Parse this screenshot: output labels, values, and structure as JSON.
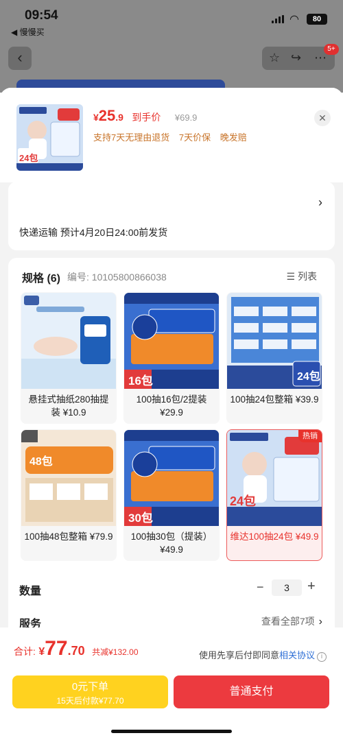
{
  "status": {
    "time": "09:54",
    "back_app": "◀ 慢慢买",
    "battery": "80"
  },
  "background": {
    "badge": "5+"
  },
  "header": {
    "price_symbol": "¥",
    "price_int": "25",
    "price_dec": ".9",
    "price_tag": "到手价",
    "original_price": "¥69.9",
    "tags": [
      "支持7天无理由退货",
      "7天价保",
      "晚发赔"
    ],
    "thumb_text": "24包"
  },
  "shipping": {
    "text": "快递运输  预计4月20日24:00前发货"
  },
  "spec": {
    "title": "规格 (6)",
    "code": "编号: 10105800866038",
    "list_view_label": "列表",
    "options": [
      {
        "name": "悬挂式抽纸280抽提装 ¥10.9",
        "selected": false
      },
      {
        "name": "100抽16包/2提装 ¥29.9",
        "selected": false,
        "img_text": "16包"
      },
      {
        "name": "100抽24包整箱 ¥39.9",
        "selected": false,
        "img_text": "24包"
      },
      {
        "name": "100抽48包整箱 ¥79.9",
        "selected": false,
        "img_text": "48包"
      },
      {
        "name": "100抽30包（提装） ¥49.9",
        "selected": false,
        "img_text": "30包"
      },
      {
        "name": "维达100抽24包 ¥49.9",
        "selected": true,
        "img_text": "24包",
        "badge": "热销"
      }
    ]
  },
  "quantity": {
    "label": "数量",
    "value": "3"
  },
  "service": {
    "label": "服务",
    "link": "查看全部7项"
  },
  "footer": {
    "total_label": "合计:",
    "total_symbol": "¥",
    "total_int": "77",
    "total_dec": ".70",
    "savings": "共减¥132.00",
    "agree_text": "使用先享后付即同意",
    "agree_link": "相关协议",
    "credit_btn_line1": "0元下单",
    "credit_btn_line2": "15天后付款¥77.70",
    "pay_btn": "普通支付"
  },
  "colors": {
    "accent": "#e8322c",
    "pay_button": "#ec3a3f",
    "credit_button": "#ffd21f",
    "link": "#2e6fd6"
  }
}
